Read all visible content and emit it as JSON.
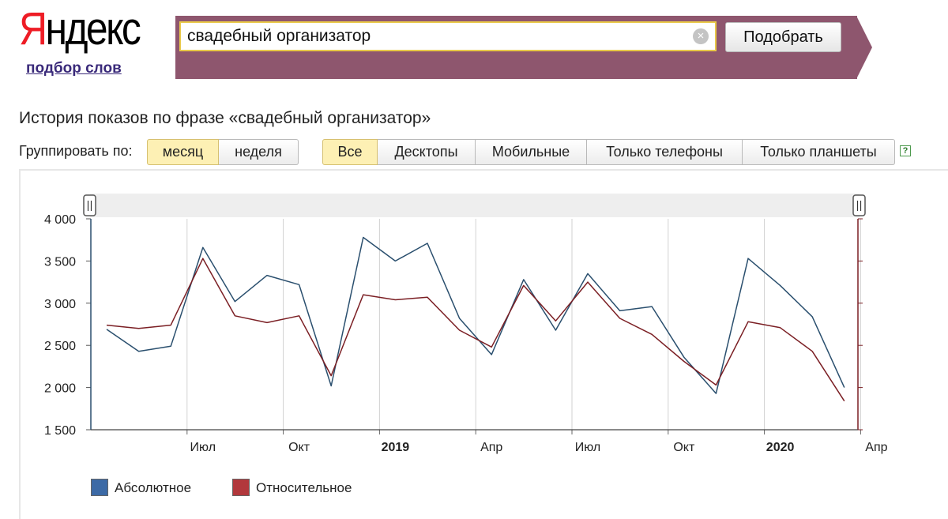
{
  "logo": {
    "first_letter": "Я",
    "rest": "ндекс"
  },
  "service_link": "подбор слов",
  "search": {
    "value": "свадебный организатор",
    "clear_icon": "×",
    "submit_label": "Подобрать"
  },
  "page_title": "История показов по фразе «свадебный организатор»",
  "group": {
    "label": "Группировать по:",
    "options": [
      "месяц",
      "неделя"
    ],
    "selected": "месяц"
  },
  "devices": {
    "options": [
      "Все",
      "Десктопы",
      "Мобильные",
      "Только телефоны",
      "Только планшеты"
    ],
    "selected": "Все",
    "help_icon": "?"
  },
  "chart_data": {
    "type": "line",
    "y_tick_labels": [
      "4 000",
      "3 500",
      "3 000",
      "2 500",
      "2 000",
      "1 500"
    ],
    "ylim": [
      1500,
      4000
    ],
    "x_tick_labels": [
      {
        "label": "Июл",
        "bold": false
      },
      {
        "label": "Окт",
        "bold": false
      },
      {
        "label": "2019",
        "bold": true
      },
      {
        "label": "Апр",
        "bold": false
      },
      {
        "label": "Июл",
        "bold": false
      },
      {
        "label": "Окт",
        "bold": false
      },
      {
        "label": "2020",
        "bold": true
      },
      {
        "label": "Апр",
        "bold": false
      }
    ],
    "x": [
      "2018-04",
      "2018-05",
      "2018-06",
      "2018-07",
      "2018-08",
      "2018-09",
      "2018-10",
      "2018-11",
      "2018-12",
      "2019-01",
      "2019-02",
      "2019-03",
      "2019-04",
      "2019-05",
      "2019-06",
      "2019-07",
      "2019-08",
      "2019-09",
      "2019-10",
      "2019-11",
      "2019-12",
      "2020-01",
      "2020-02",
      "2020-03",
      "2020-04"
    ],
    "series": [
      {
        "name": "Абсолютное",
        "color": "#2a4f6e",
        "values": [
          2690,
          2430,
          2490,
          3660,
          3020,
          3330,
          3220,
          2020,
          3780,
          3500,
          3710,
          2820,
          2390,
          3280,
          2680,
          3350,
          2910,
          2960,
          2360,
          1930,
          3530,
          3210,
          2840,
          2000,
          null
        ]
      },
      {
        "name": "Относительное",
        "color": "#7b1f24",
        "values": [
          2740,
          2700,
          2740,
          3530,
          2850,
          2770,
          2850,
          2140,
          3100,
          3040,
          3070,
          2680,
          2480,
          3210,
          2790,
          3250,
          2820,
          2630,
          2310,
          2030,
          2780,
          2710,
          2430,
          1840,
          null
        ]
      }
    ],
    "legend_placement": "bottom-left",
    "grid": "vertical"
  },
  "legend": {
    "items": [
      {
        "label": "Абсолютное",
        "color": "#3c6aa6"
      },
      {
        "label": "Относительное",
        "color": "#b2383c"
      }
    ]
  }
}
